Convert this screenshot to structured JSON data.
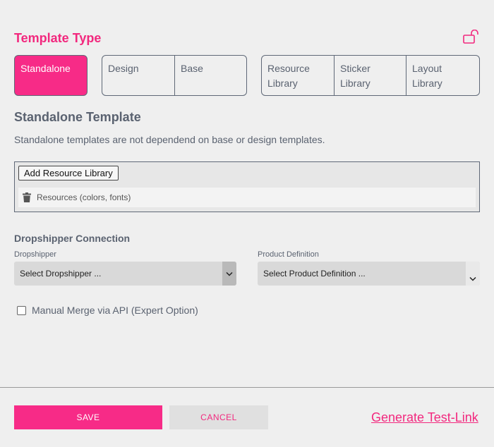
{
  "header": {
    "title": "Template Type",
    "lock_icon": "unlock-icon"
  },
  "template_types": {
    "standalone": "Standalone",
    "design": "Design",
    "base": "Base",
    "resource_library": "Resource Library",
    "sticker_library": "Sticker Library",
    "layout_library": "Layout Library",
    "active": "Standalone"
  },
  "section": {
    "title": "Standalone Template",
    "description": "Standalone templates are not dependend on base or design templates."
  },
  "resources": {
    "add_button": "Add Resource Library",
    "items": [
      "Resources (colors, fonts)"
    ]
  },
  "dropshipper": {
    "title": "Dropshipper Connection",
    "dropshipper_label": "Dropshipper",
    "dropshipper_value": "Select Dropshipper ...",
    "product_label": "Product Definition",
    "product_value": "Select Product Definition ..."
  },
  "merge": {
    "label": "Manual Merge via API (Expert Option)",
    "checked": false
  },
  "footer": {
    "save": "SAVE",
    "cancel": "CANCEL",
    "test_link": "Generate Test-Link"
  },
  "colors": {
    "accent": "#f72b87",
    "text": "#5a6270",
    "background": "#efefef"
  }
}
